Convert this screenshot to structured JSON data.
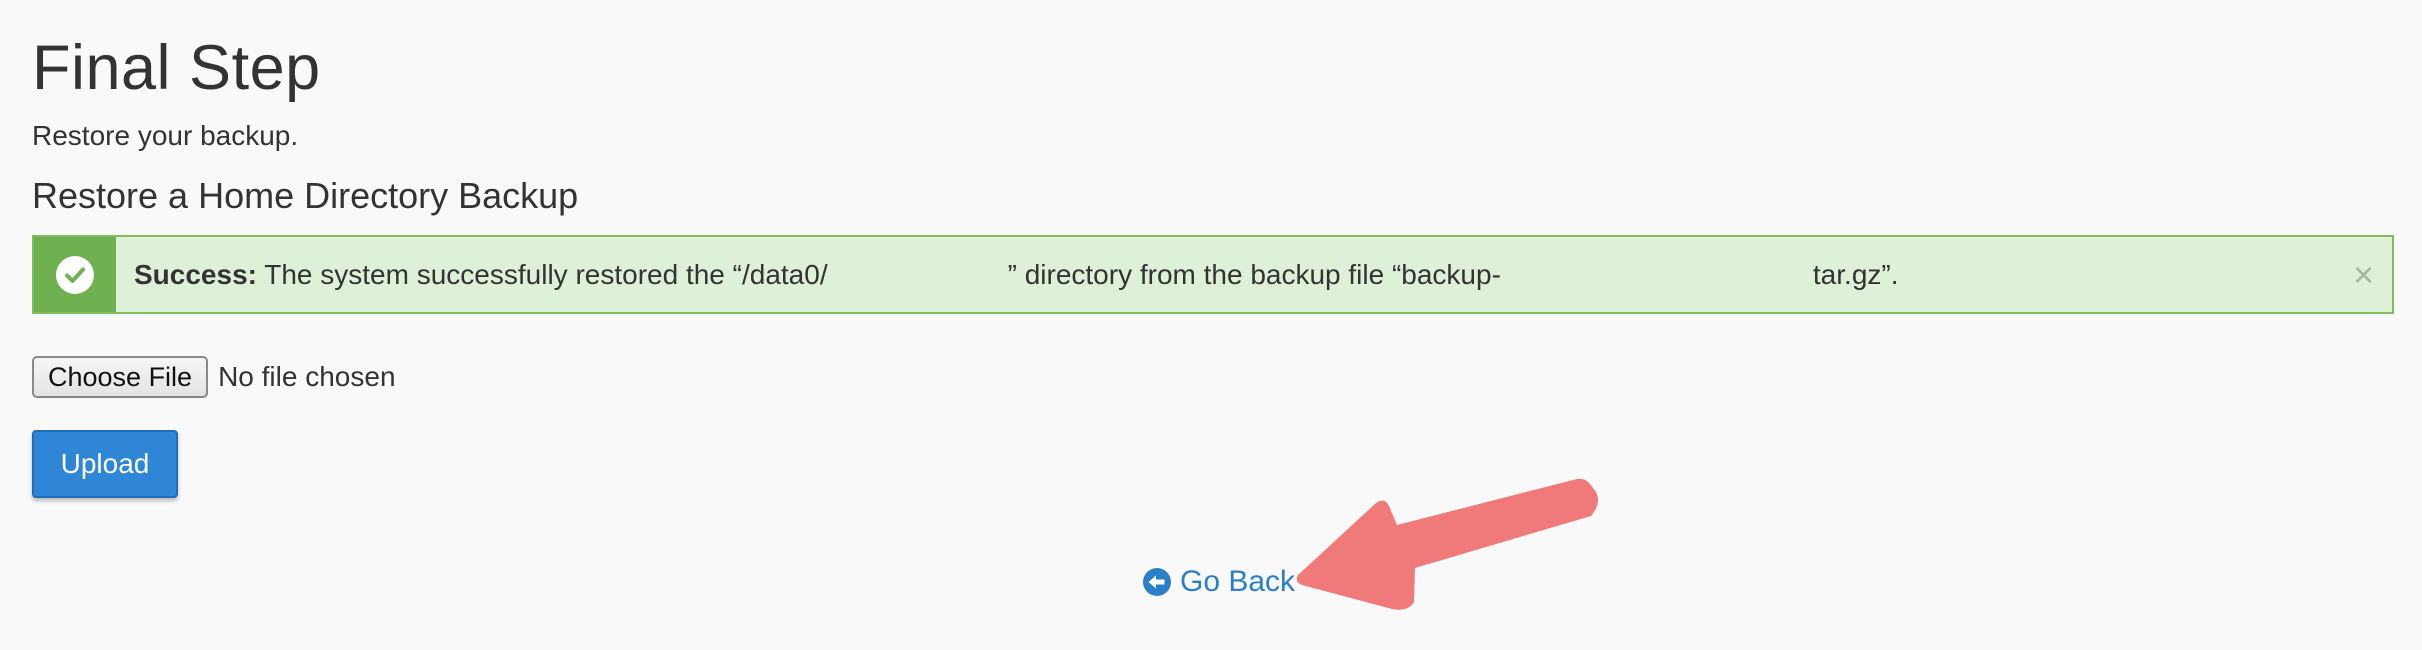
{
  "page": {
    "title": "Final Step",
    "description": "Restore your backup."
  },
  "section": {
    "title": "Restore a Home Directory Backup"
  },
  "alert": {
    "type": "success",
    "icon": "check-circle-icon",
    "label": "Success:",
    "text_part1": " The system successfully restored the “/data0/",
    "text_part2": "” directory from the backup file “backup-",
    "text_part3": "tar.gz”.",
    "close_symbol": "×",
    "colors": {
      "background": "#dff0d8",
      "border": "#7fbf5b",
      "icon_box": "#6fb151"
    }
  },
  "file_input": {
    "button_label": "Choose File",
    "status": "No file chosen"
  },
  "upload": {
    "label": "Upload",
    "color": "#2f86d6"
  },
  "go_back": {
    "icon": "arrow-circle-left-icon",
    "label": "Go Back",
    "color": "#2a7fc8"
  },
  "annotation": {
    "icon": "pointer-arrow-icon",
    "color": "#f07a7a"
  }
}
